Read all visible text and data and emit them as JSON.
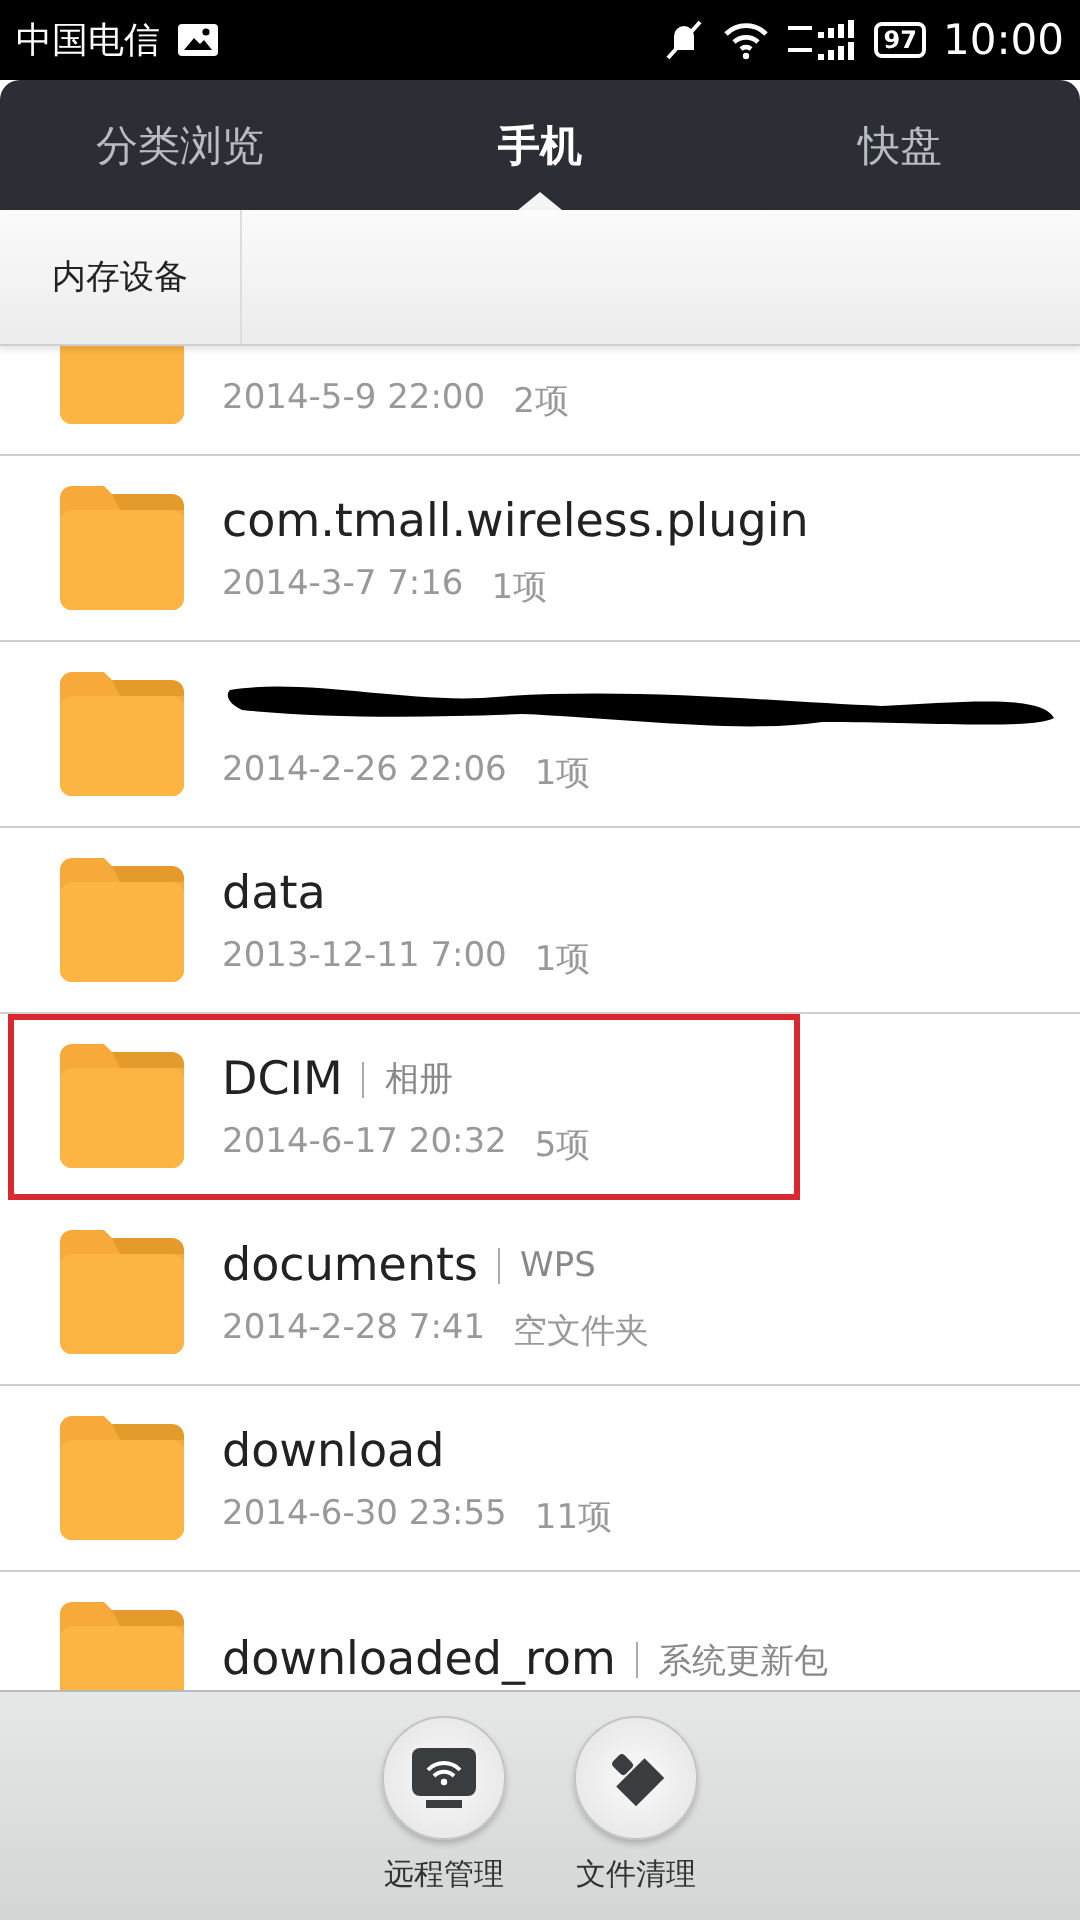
{
  "status_bar": {
    "carrier": "中国电信",
    "battery": "97",
    "time": "10:00"
  },
  "tabs": [
    {
      "label": "分类浏览",
      "selected": false
    },
    {
      "label": "手机",
      "selected": true
    },
    {
      "label": "快盘",
      "selected": false
    }
  ],
  "breadcrumb": [
    "内存设备"
  ],
  "files": [
    {
      "date": "2014-5-9 22:00",
      "count": "2项",
      "highlighted": false,
      "redacted": false
    },
    {
      "name": "com.tmall.wireless.plugin",
      "date": "2014-3-7 7:16",
      "count": "1项",
      "highlighted": false,
      "redacted": false
    },
    {
      "date": "2014-2-26 22:06",
      "count": "1项",
      "highlighted": false,
      "redacted": true
    },
    {
      "name": "data",
      "date": "2013-12-11 7:00",
      "count": "1项",
      "highlighted": false,
      "redacted": false
    },
    {
      "name": "DCIM",
      "tag": "相册",
      "date": "2014-6-17 20:32",
      "count": "5项",
      "highlighted": true,
      "redacted": false
    },
    {
      "name": "documents",
      "tag": "WPS",
      "date": "2014-2-28 7:41",
      "count": "空文件夹",
      "highlighted": false,
      "redacted": false
    },
    {
      "name": "download",
      "date": "2014-6-30 23:55",
      "count": "11项",
      "highlighted": false,
      "redacted": false
    },
    {
      "name": "downloaded_rom",
      "tag": "系统更新包",
      "highlighted": false,
      "redacted": false
    }
  ],
  "actions": [
    {
      "kind": "remote",
      "label": "远程管理"
    },
    {
      "kind": "clean",
      "label": "文件清理"
    }
  ]
}
